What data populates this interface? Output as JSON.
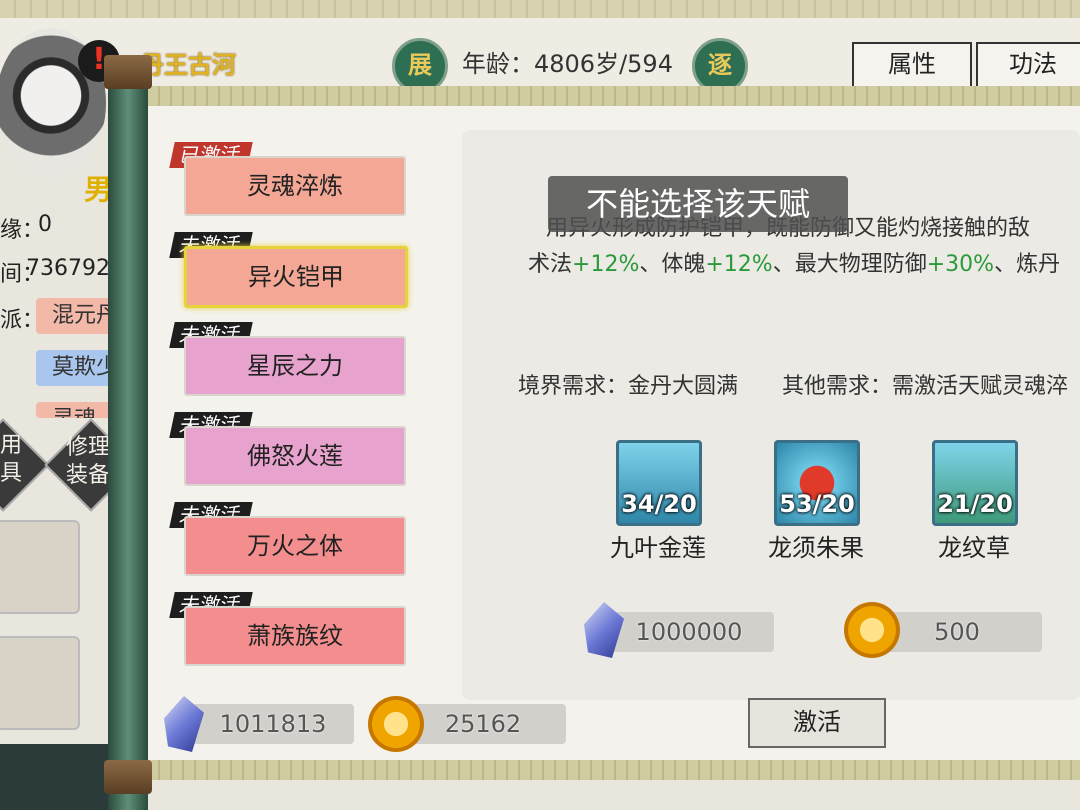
{
  "header": {
    "character_name": "丹王古河",
    "left_seal": "展",
    "right_seal": "逐",
    "age_text": "年龄：4806岁/594",
    "buttons": [
      "属性",
      "功法"
    ]
  },
  "left_panel": {
    "gender": "男",
    "stat1_label": "缘：",
    "stat1_value": "0",
    "stat2_label": "间：",
    "stat2_value": "736792",
    "stat3_label": "派：",
    "tags": [
      "混元丹",
      "莫欺少",
      "灵魂"
    ],
    "side_buttons": [
      "用具",
      "修理装备"
    ]
  },
  "talents": [
    {
      "status": "已激活",
      "name": "灵魂淬炼",
      "style": "salmon",
      "active": true
    },
    {
      "status": "未激活",
      "name": "异火铠甲",
      "style": "salmon",
      "selected": true
    },
    {
      "status": "未激活",
      "name": "星辰之力",
      "style": "pink"
    },
    {
      "status": "未激活",
      "name": "佛怒火莲",
      "style": "pink"
    },
    {
      "status": "未激活",
      "name": "万火之体",
      "style": "red"
    },
    {
      "status": "未激活",
      "name": "萧族族纹",
      "style": "red"
    }
  ],
  "detail": {
    "toast": "不能选择该天赋",
    "desc_line1": "用异火形成防护铠甲，既能防御又能灼烧接触的敌",
    "desc_line2_parts": [
      "术法",
      "+12%",
      "、体魄",
      "+12%",
      "、最大物理防御",
      "+30%",
      "、炼丹"
    ],
    "req_realm": "境界需求：金丹大圆满",
    "req_other": "其他需求：需激活天赋灵魂淬",
    "materials": [
      {
        "name": "九叶金莲",
        "count": "34/20",
        "icon": "lotus-icon"
      },
      {
        "name": "龙须朱果",
        "count": "53/20",
        "icon": "fruit-icon"
      },
      {
        "name": "龙纹草",
        "count": "21/20",
        "icon": "herb-icon"
      }
    ],
    "cost_crystal": "1000000",
    "cost_gold": "500",
    "activate_label": "激活"
  },
  "currency": {
    "crystal": "1011813",
    "gold": "25162"
  },
  "colors": {
    "salmon": "#f3a794",
    "pink": "#e7a2cd",
    "red": "#f48e8e",
    "green_stat": "#2a9a3a",
    "name_gold": "#e1b321"
  }
}
